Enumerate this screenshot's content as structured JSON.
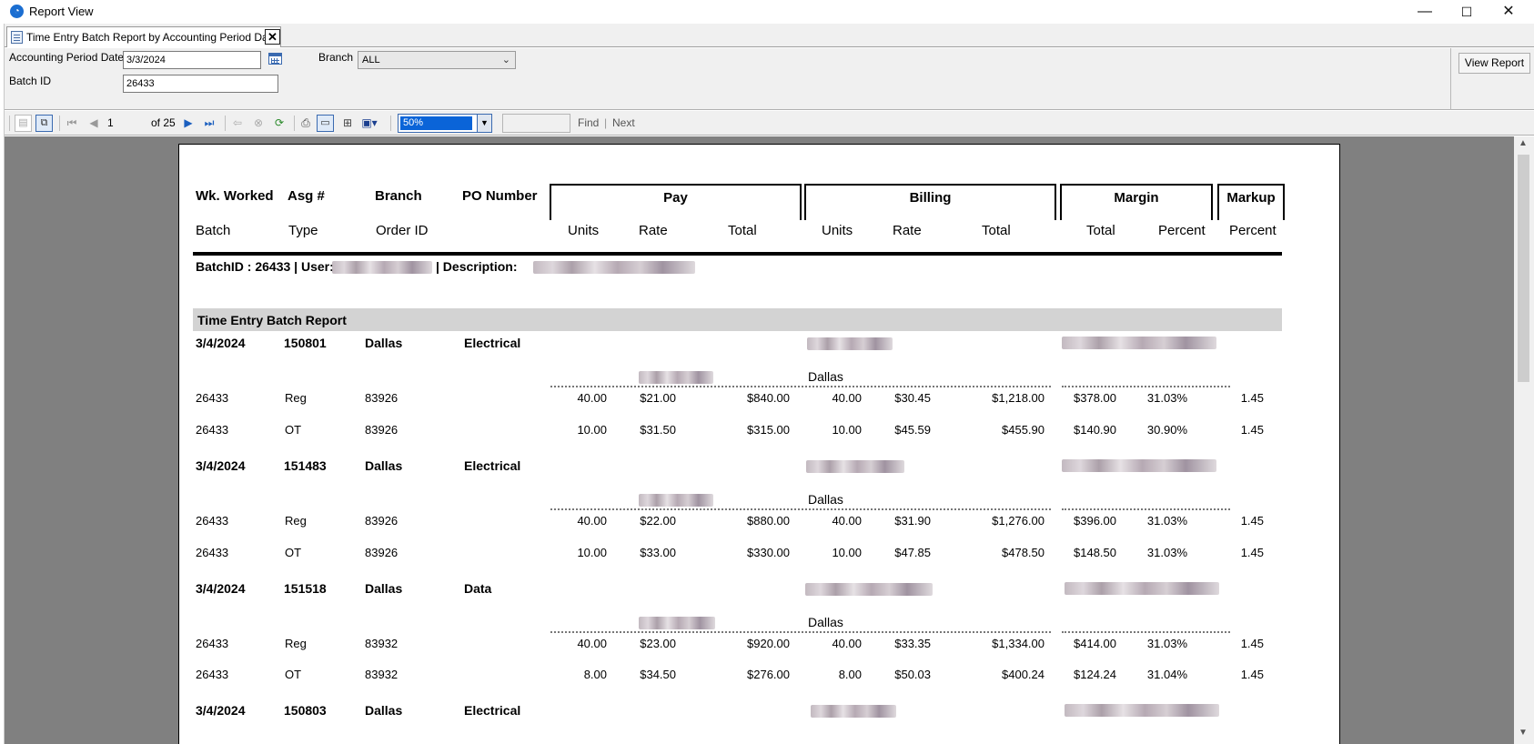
{
  "window": {
    "title": "Report View",
    "minimize_glyph": "—",
    "maximize_glyph": "☐",
    "close_glyph": "✕"
  },
  "tab": {
    "label": "Time Entry Batch Report by Accounting Period Date",
    "close_glyph": "✕"
  },
  "params": {
    "accounting_period_label": "Accounting Period Date",
    "accounting_period_value": "3/3/2024",
    "batch_id_label": "Batch ID",
    "batch_id_value": "26433",
    "branch_label": "Branch",
    "branch_value": "ALL",
    "view_report_label": "View Report"
  },
  "toolbar": {
    "current_page": "1",
    "page_of": "of  25",
    "zoom": "50%",
    "find_label": "Find",
    "separator": "|",
    "next_label": "Next"
  },
  "report": {
    "header_row1": {
      "wk_worked": "Wk. Worked",
      "asg": "Asg #",
      "branch": "Branch",
      "po_number": "PO Number",
      "pay": "Pay",
      "billing": "Billing",
      "margin": "Margin",
      "markup": "Markup"
    },
    "header_row2": {
      "batch": "Batch",
      "type": "Type",
      "order_id": "Order ID",
      "pay_units": "Units",
      "pay_rate": "Rate",
      "pay_total": "Total",
      "bill_units": "Units",
      "bill_rate": "Rate",
      "bill_total": "Total",
      "margin_total": "Total",
      "margin_percent": "Percent",
      "markup_percent": "Percent"
    },
    "batch_line": {
      "batch_id": "BatchID : 26433 | User:",
      "description": "| Description:"
    },
    "section_title": "Time Entry Batch Report",
    "groups": [
      {
        "date": "3/4/2024",
        "asg": "150801",
        "branch": "Dallas",
        "po": "Electrical",
        "location": "Dallas",
        "lines": [
          {
            "batch": "26433",
            "type": "Reg",
            "order": "83926",
            "pay_units": "40.00",
            "pay_rate": "$21.00",
            "pay_total": "$840.00",
            "bill_units": "40.00",
            "bill_rate": "$30.45",
            "bill_total": "$1,218.00",
            "margin_total": "$378.00",
            "margin_pct": "31.03%",
            "markup": "1.45"
          },
          {
            "batch": "26433",
            "type": "OT",
            "order": "83926",
            "pay_units": "10.00",
            "pay_rate": "$31.50",
            "pay_total": "$315.00",
            "bill_units": "10.00",
            "bill_rate": "$45.59",
            "bill_total": "$455.90",
            "margin_total": "$140.90",
            "margin_pct": "30.90%",
            "markup": "1.45"
          }
        ]
      },
      {
        "date": "3/4/2024",
        "asg": "151483",
        "branch": "Dallas",
        "po": "Electrical",
        "location": "Dallas",
        "lines": [
          {
            "batch": "26433",
            "type": "Reg",
            "order": "83926",
            "pay_units": "40.00",
            "pay_rate": "$22.00",
            "pay_total": "$880.00",
            "bill_units": "40.00",
            "bill_rate": "$31.90",
            "bill_total": "$1,276.00",
            "margin_total": "$396.00",
            "margin_pct": "31.03%",
            "markup": "1.45"
          },
          {
            "batch": "26433",
            "type": "OT",
            "order": "83926",
            "pay_units": "10.00",
            "pay_rate": "$33.00",
            "pay_total": "$330.00",
            "bill_units": "10.00",
            "bill_rate": "$47.85",
            "bill_total": "$478.50",
            "margin_total": "$148.50",
            "margin_pct": "31.03%",
            "markup": "1.45"
          }
        ]
      },
      {
        "date": "3/4/2024",
        "asg": "151518",
        "branch": "Dallas",
        "po": "Data",
        "location": "Dallas",
        "lines": [
          {
            "batch": "26433",
            "type": "Reg",
            "order": "83932",
            "pay_units": "40.00",
            "pay_rate": "$23.00",
            "pay_total": "$920.00",
            "bill_units": "40.00",
            "bill_rate": "$33.35",
            "bill_total": "$1,334.00",
            "margin_total": "$414.00",
            "margin_pct": "31.03%",
            "markup": "1.45"
          },
          {
            "batch": "26433",
            "type": "OT",
            "order": "83932",
            "pay_units": "8.00",
            "pay_rate": "$34.50",
            "pay_total": "$276.00",
            "bill_units": "8.00",
            "bill_rate": "$50.03",
            "bill_total": "$400.24",
            "margin_total": "$124.24",
            "margin_pct": "31.04%",
            "markup": "1.45"
          }
        ]
      },
      {
        "date": "3/4/2024",
        "asg": "150803",
        "branch": "Dallas",
        "po": "Electrical",
        "lines": []
      }
    ]
  }
}
